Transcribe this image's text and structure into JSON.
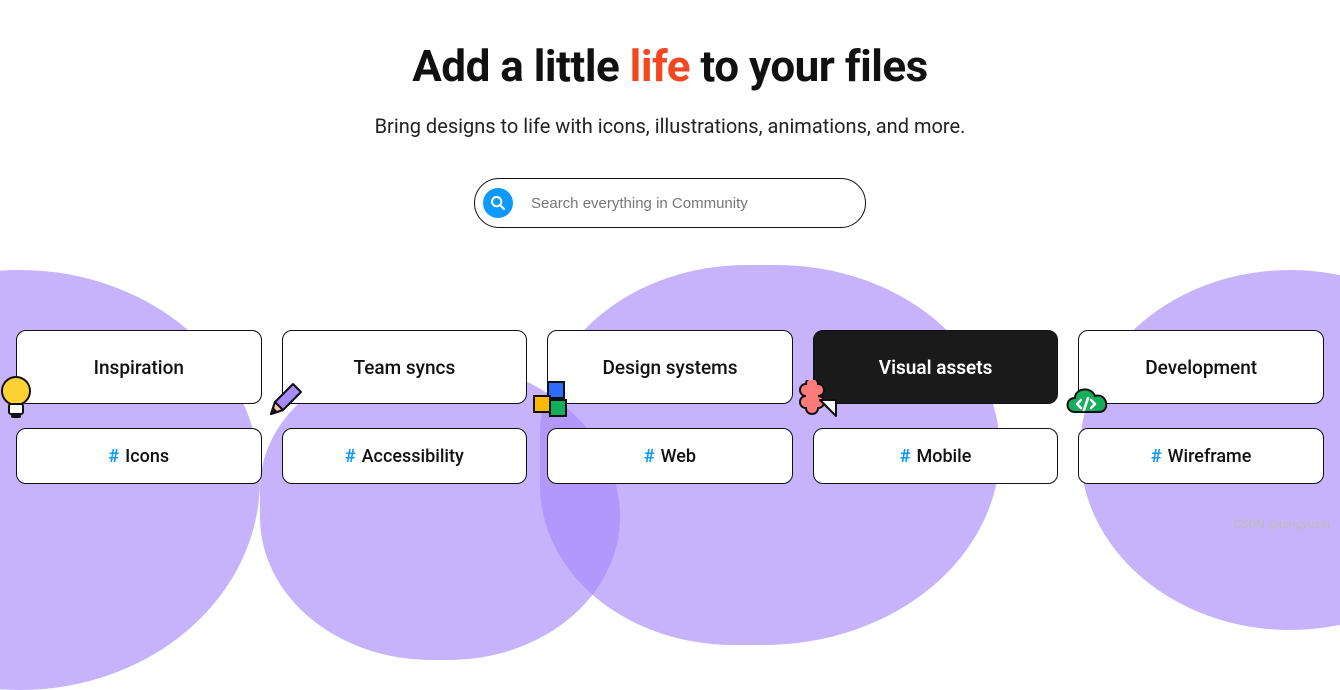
{
  "hero": {
    "title_pre": "Add a little ",
    "title_accent": "life",
    "title_post": " to your files",
    "subtitle": "Bring designs to life with icons, illustrations, animations, and more."
  },
  "search": {
    "placeholder": "Search everything in Community"
  },
  "categories": [
    {
      "label": "Inspiration",
      "icon": "bulb",
      "active": false
    },
    {
      "label": "Team syncs",
      "icon": "pencil",
      "active": false
    },
    {
      "label": "Design systems",
      "icon": "blocks",
      "active": false
    },
    {
      "label": "Visual assets",
      "icon": "shape",
      "active": true
    },
    {
      "label": "Development",
      "icon": "cloud",
      "active": false
    }
  ],
  "tags": [
    {
      "label": "Icons"
    },
    {
      "label": "Accessibility"
    },
    {
      "label": "Web"
    },
    {
      "label": "Mobile"
    },
    {
      "label": "Wireframe"
    }
  ],
  "watermark": "CSDN @tengyuxin"
}
